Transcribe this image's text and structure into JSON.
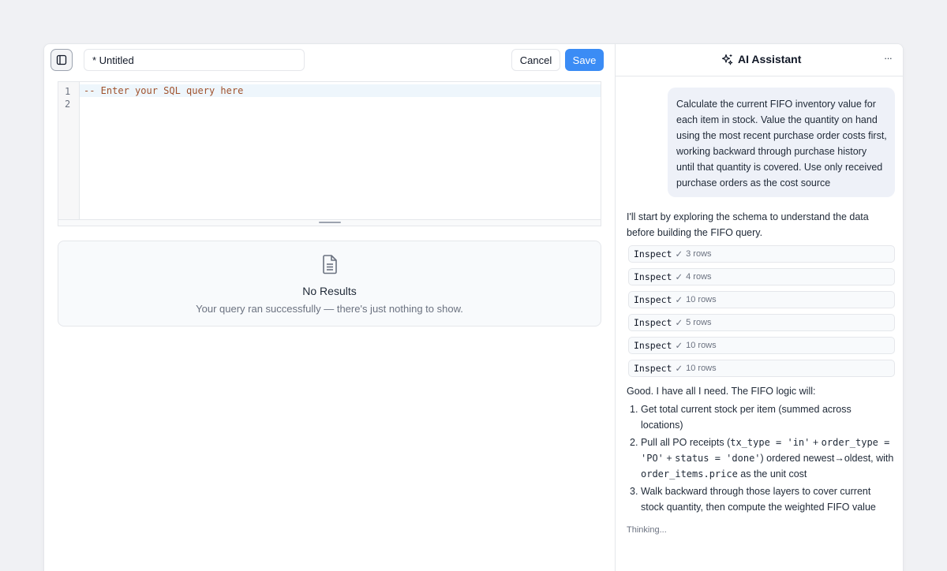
{
  "toolbar": {
    "title_value": "* Untitled",
    "cancel_label": "Cancel",
    "save_label": "Save"
  },
  "editor": {
    "line_numbers": [
      "1",
      "2"
    ],
    "lines": [
      "-- Enter your SQL query here",
      ""
    ]
  },
  "results": {
    "title": "No Results",
    "subtitle": "Your query ran successfully — there's just nothing to show."
  },
  "assistant": {
    "title": "AI Assistant",
    "more_label": "···",
    "user_message": "Calculate the current FIFO inventory value for each item in stock. Value the quantity on hand using the most recent purchase order costs first, working backward through purchase history until that quantity is covered. Use only received purchase orders as the cost source",
    "intro": "I'll start by exploring the schema to understand the data before building the FIFO query.",
    "tool_calls": [
      {
        "name": "Inspect",
        "check": "✓",
        "rows": "3 rows"
      },
      {
        "name": "Inspect",
        "check": "✓",
        "rows": "4 rows"
      },
      {
        "name": "Inspect",
        "check": "✓",
        "rows": "10 rows"
      },
      {
        "name": "Inspect",
        "check": "✓",
        "rows": "5 rows"
      },
      {
        "name": "Inspect",
        "check": "✓",
        "rows": "10 rows"
      },
      {
        "name": "Inspect",
        "check": "✓",
        "rows": "10 rows"
      }
    ],
    "plan_intro": "Good. I have all I need. The FIFO logic will:",
    "steps": {
      "s1": {
        "num": "1.",
        "text": "Get total current stock per item (summed across locations)"
      },
      "s2": {
        "num": "2.",
        "a": "Pull all PO receipts (",
        "code1": "tx_type = 'in'",
        "b": " + ",
        "code2": "order_type = 'PO'",
        "c": " + ",
        "code3": "status = 'done'",
        "d": ") ordered newest→oldest, with ",
        "code4": "order_items.price",
        "e": " as the unit cost"
      },
      "s3": {
        "num": "3.",
        "text": "Walk backward through those layers to cover current stock quantity, then compute the weighted FIFO value"
      }
    },
    "status": "Thinking..."
  }
}
